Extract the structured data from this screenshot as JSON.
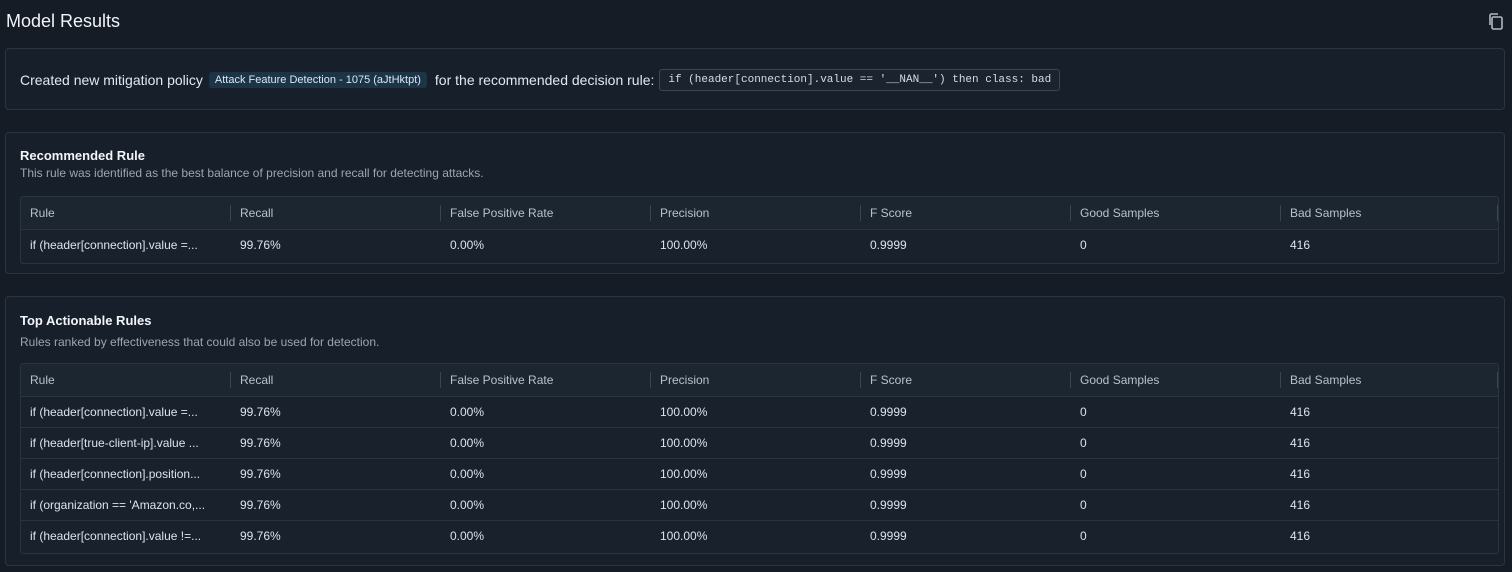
{
  "header": {
    "title": "Model Results",
    "copy_icon": "copy-icon"
  },
  "policy": {
    "prefix": "Created new mitigation policy",
    "badge": "Attack Feature Detection - 1075 (aJtHktpt)",
    "middle": "for the recommended decision rule:",
    "code": "if (header[connection].value == '__NAN__') then class: bad"
  },
  "recommended": {
    "title": "Recommended Rule",
    "subtitle": "This rule was identified as the best balance of precision and recall for detecting attacks.",
    "columns": [
      "Rule",
      "Recall",
      "False Positive Rate",
      "Precision",
      "F Score",
      "Good Samples",
      "Bad Samples"
    ],
    "rows": [
      [
        "if (header[connection].value =...",
        "99.76%",
        "0.00%",
        "100.00%",
        "0.9999",
        "0",
        "416"
      ]
    ]
  },
  "top": {
    "title": "Top Actionable Rules",
    "subtitle": "Rules ranked by effectiveness that could also be used for detection.",
    "columns": [
      "Rule",
      "Recall",
      "False Positive Rate",
      "Precision",
      "F Score",
      "Good Samples",
      "Bad Samples"
    ],
    "rows": [
      [
        "if (header[connection].value =...",
        "99.76%",
        "0.00%",
        "100.00%",
        "0.9999",
        "0",
        "416"
      ],
      [
        "if (header[true-client-ip].value ...",
        "99.76%",
        "0.00%",
        "100.00%",
        "0.9999",
        "0",
        "416"
      ],
      [
        "if (header[connection].position...",
        "99.76%",
        "0.00%",
        "100.00%",
        "0.9999",
        "0",
        "416"
      ],
      [
        "if (organization == 'Amazon.co,...",
        "99.76%",
        "0.00%",
        "100.00%",
        "0.9999",
        "0",
        "416"
      ],
      [
        "if (header[connection].value !=...",
        "99.76%",
        "0.00%",
        "100.00%",
        "0.9999",
        "0",
        "416"
      ]
    ]
  }
}
